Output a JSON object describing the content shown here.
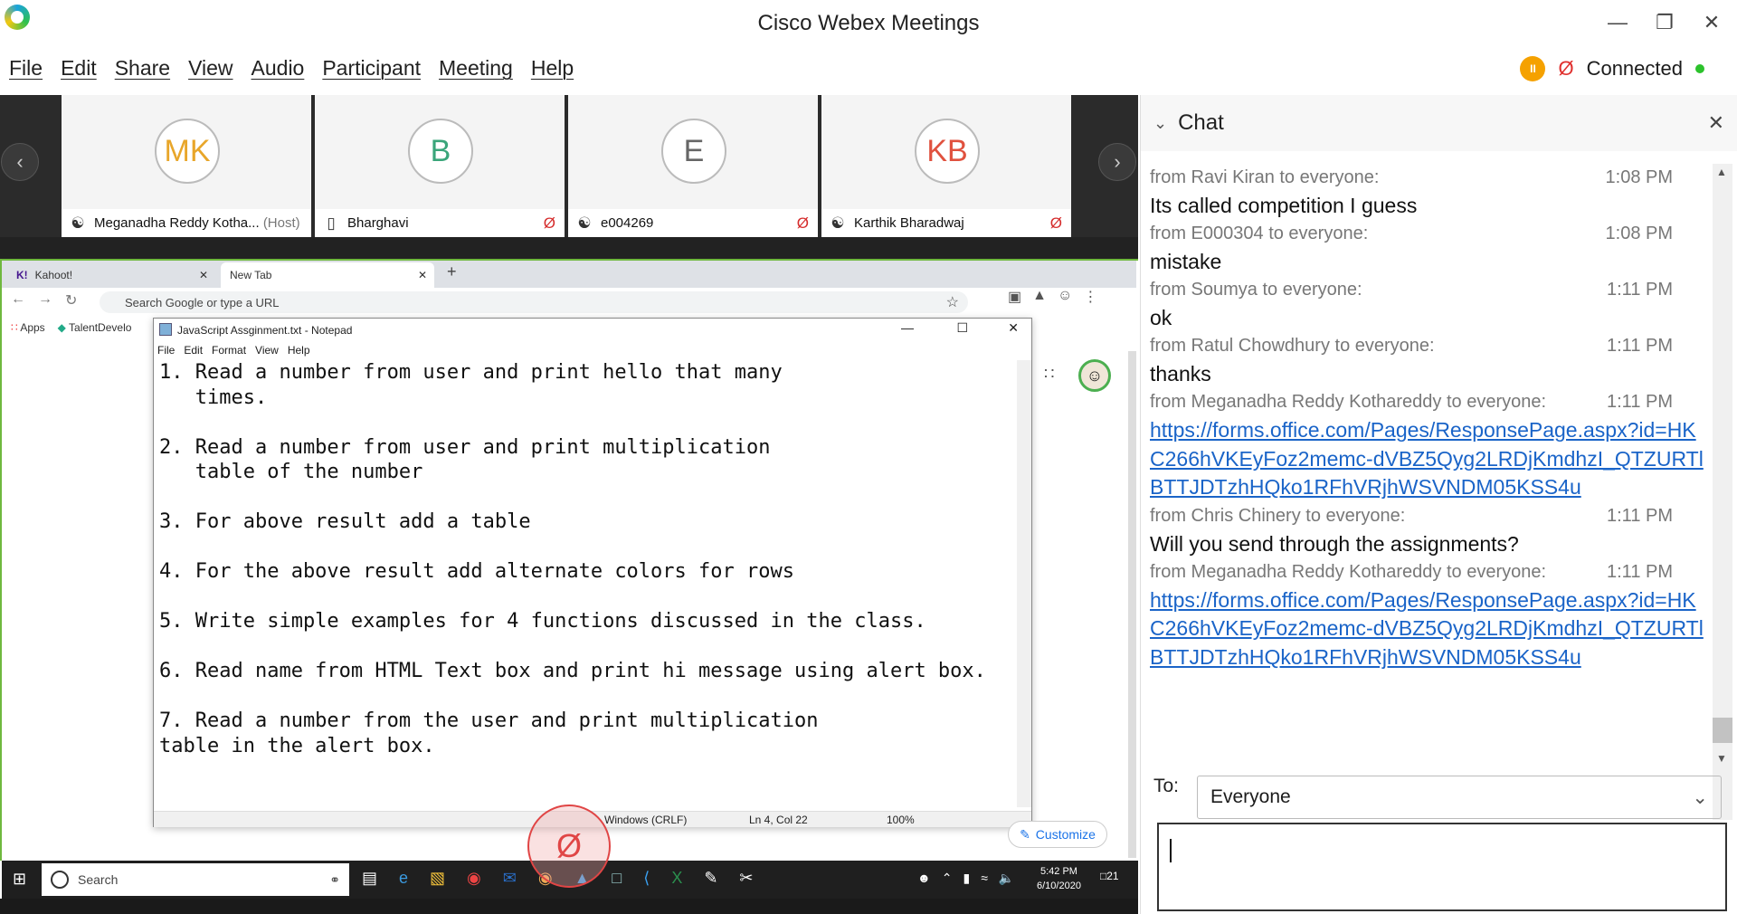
{
  "app": {
    "title": "Cisco Webex Meetings",
    "status": "Connected"
  },
  "menu": [
    "File",
    "Edit",
    "Share",
    "View",
    "Audio",
    "Participant",
    "Meeting",
    "Help"
  ],
  "participants": [
    {
      "initials": "MK",
      "name": "Meganadha Reddy Kotha...",
      "host": "(Host)",
      "color": "#e8a62a"
    },
    {
      "initials": "B",
      "name": "Bharghavi",
      "host": "",
      "color": "#3aa57a"
    },
    {
      "initials": "E",
      "name": "e004269",
      "host": "",
      "color": "#666666"
    },
    {
      "initials": "KB",
      "name": "Karthik Bharadwaj",
      "host": "",
      "color": "#e0513e"
    }
  ],
  "browser": {
    "tab1": "Kahoot!",
    "tab2": "New Tab",
    "omnibox": "Search Google or type a URL",
    "bookmark_apps": "Apps",
    "bookmark_2": "TalentDevelo",
    "customize": "Customize"
  },
  "notepad": {
    "title": "JavaScript Assginment.txt - Notepad",
    "menu": [
      "File",
      "Edit",
      "Format",
      "View",
      "Help"
    ],
    "content": "1. Read a number from user and print hello that many\n   times.\n\n2. Read a number from user and print multiplication\n   table of the number\n\n3. For above result add a table\n\n4. For the above result add alternate colors for rows\n\n5. Write simple examples for 4 functions discussed in the class.\n\n6. Read name from HTML Text box and print hi message using alert box.\n\n7. Read a number from the user and print multiplication\ntable in the alert box.",
    "status_eol": "Windows (CRLF)",
    "status_pos": "Ln 4, Col 22",
    "status_zoom": "100%"
  },
  "taskbar": {
    "search": "Search",
    "time": "5:42 PM",
    "date": "6/10/2020",
    "notif_count": "21"
  },
  "chat": {
    "title": "Chat",
    "messages": [
      {
        "from": "from Ravi Kiran to everyone:",
        "time": "1:08 PM",
        "text": "Its called competition I guess",
        "link": false
      },
      {
        "from": "from E000304 to everyone:",
        "time": "1:08 PM",
        "text": "mistake",
        "link": false
      },
      {
        "from": "from Soumya to everyone:",
        "time": "1:11 PM",
        "text": "ok",
        "link": false
      },
      {
        "from": "from Ratul Chowdhury to everyone:",
        "time": "1:11 PM",
        "text": "thanks",
        "link": false
      },
      {
        "from": "from Meganadha Reddy Kothareddy to everyone:",
        "time": "1:11 PM",
        "text": "https://forms.office.com/Pages/ResponsePage.aspx?id=HKC266hVKEyFoz2memc-dVBZ5Qyg2LRDjKmdhzI_QTZURTlBTTJDTzhHQko1RFhVRjhWSVNDM05KSS4u",
        "link": true
      },
      {
        "from": "from Chris Chinery to everyone:",
        "time": "1:11 PM",
        "text": "Will you send through the assignments?",
        "link": false
      },
      {
        "from": "from Meganadha Reddy Kothareddy to everyone:",
        "time": "1:11 PM",
        "text": "https://forms.office.com/Pages/ResponsePage.aspx?id=HKC266hVKEyFoz2memc-dVBZ5Qyg2LRDjKmdhzI_QTZURTlBTTJDTzhHQko1RFhVRjhWSVNDM05KSS4u",
        "link": true
      }
    ],
    "to_label": "To:",
    "to_value": "Everyone"
  }
}
